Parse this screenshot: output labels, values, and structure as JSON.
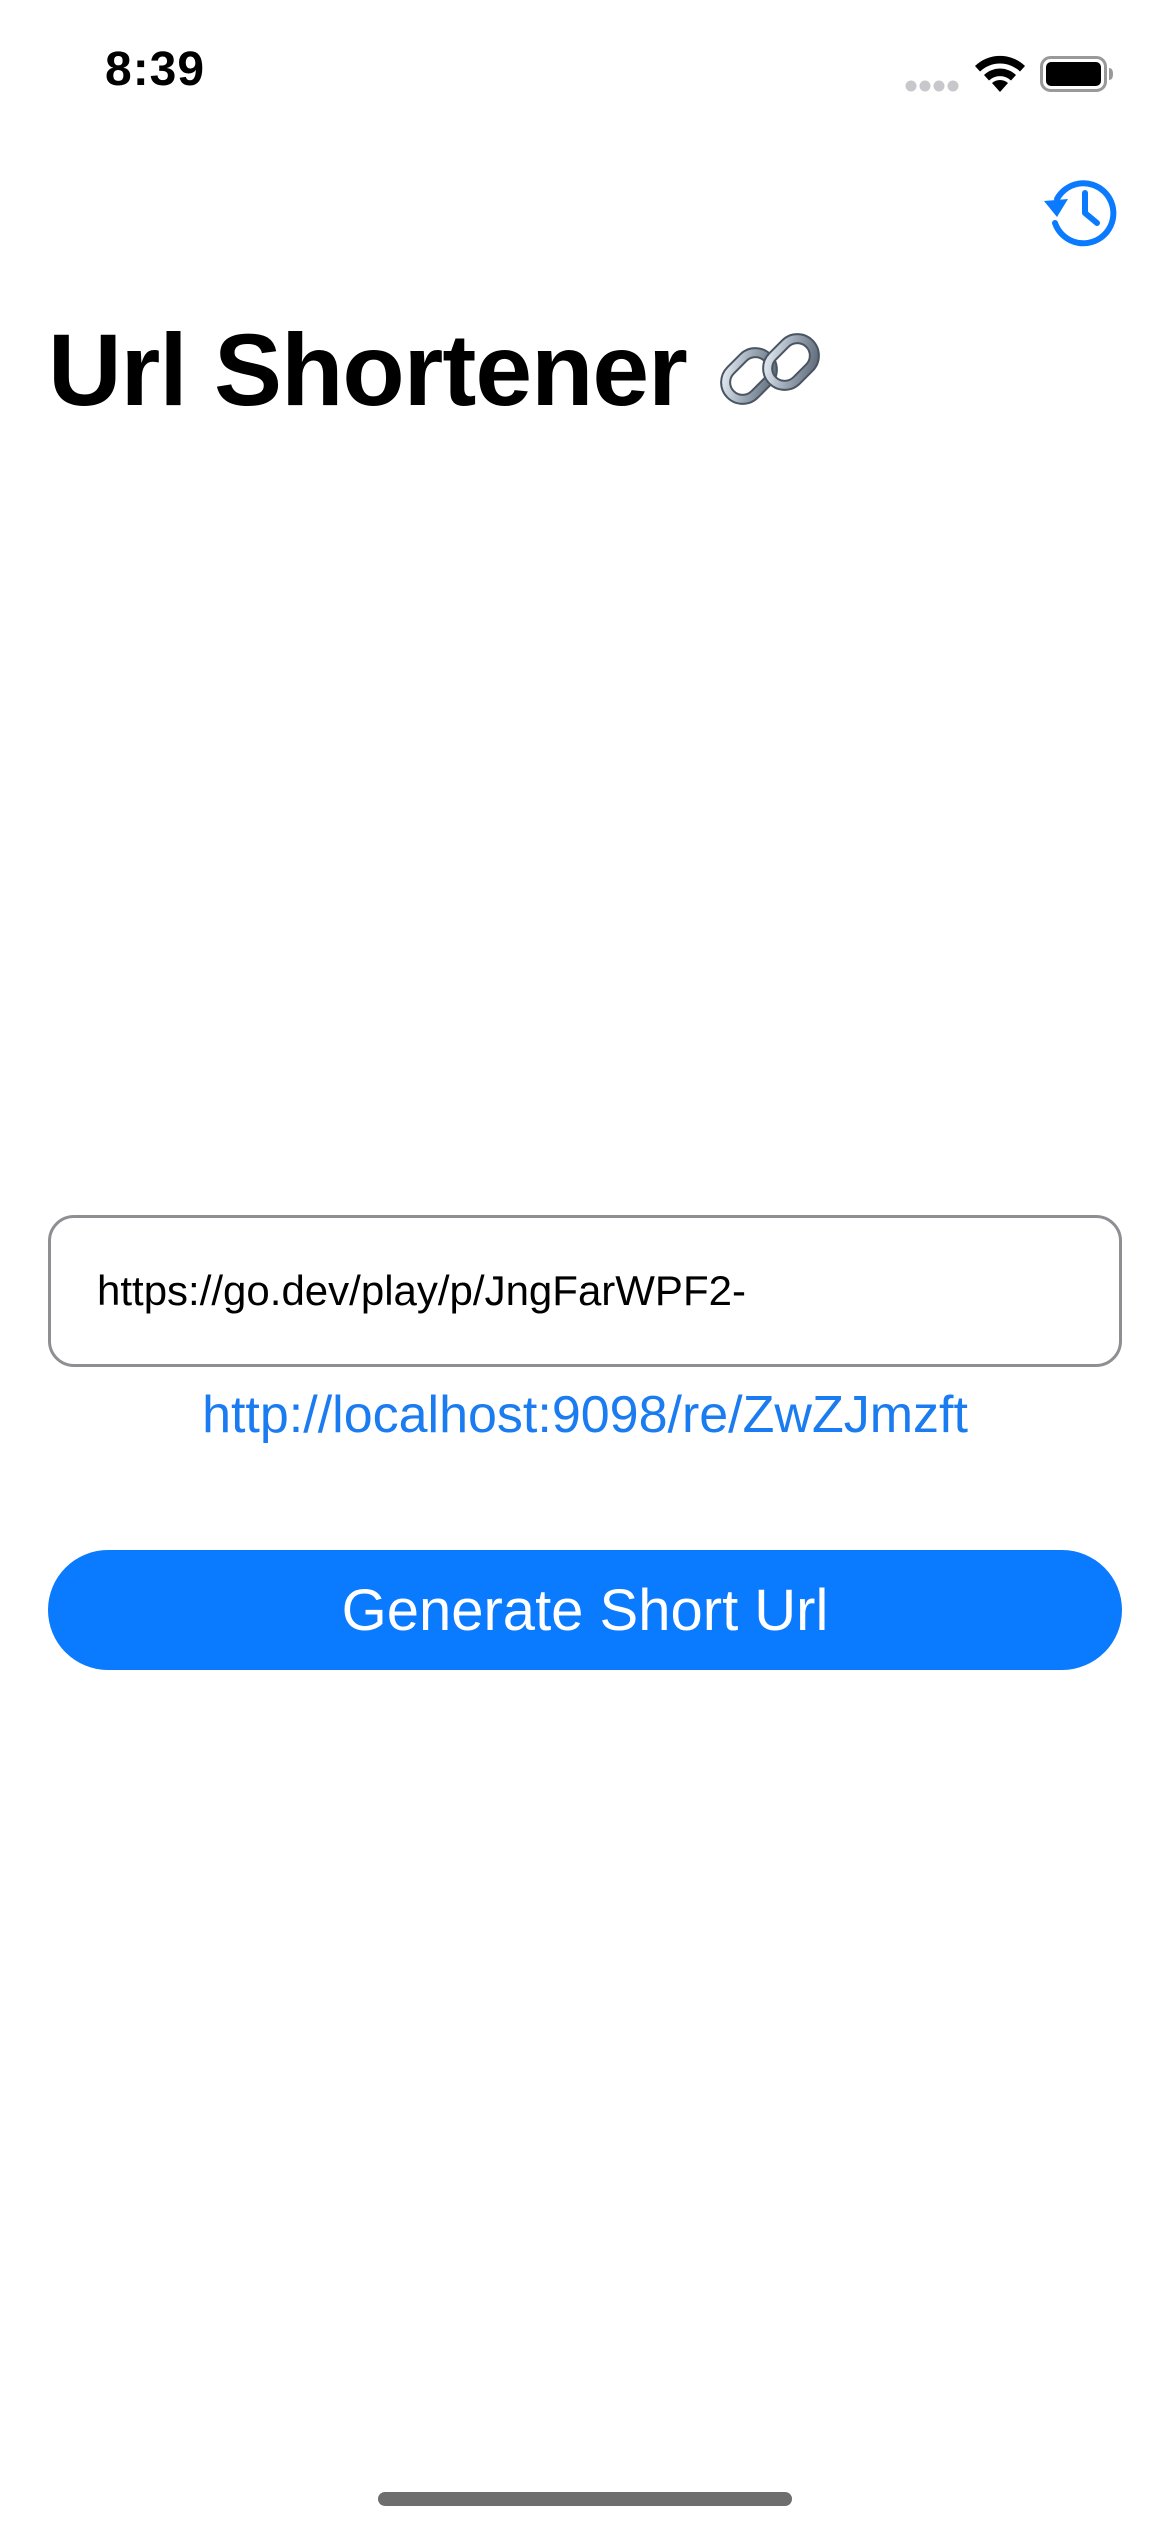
{
  "status_bar": {
    "time": "8:39"
  },
  "header": {
    "history_icon": "history-clock-icon",
    "title": "Url Shortener",
    "title_icon": "link-emoji-icon"
  },
  "form": {
    "url_input_value": "https://go.dev/play/p/JngFarWPF2-",
    "short_url": "http://localhost:9098/re/ZwZJmzft",
    "generate_label": "Generate Short Url"
  },
  "colors": {
    "accent": "#0a7aff",
    "link": "#1a7cf0",
    "input_border": "#8e8e93"
  }
}
